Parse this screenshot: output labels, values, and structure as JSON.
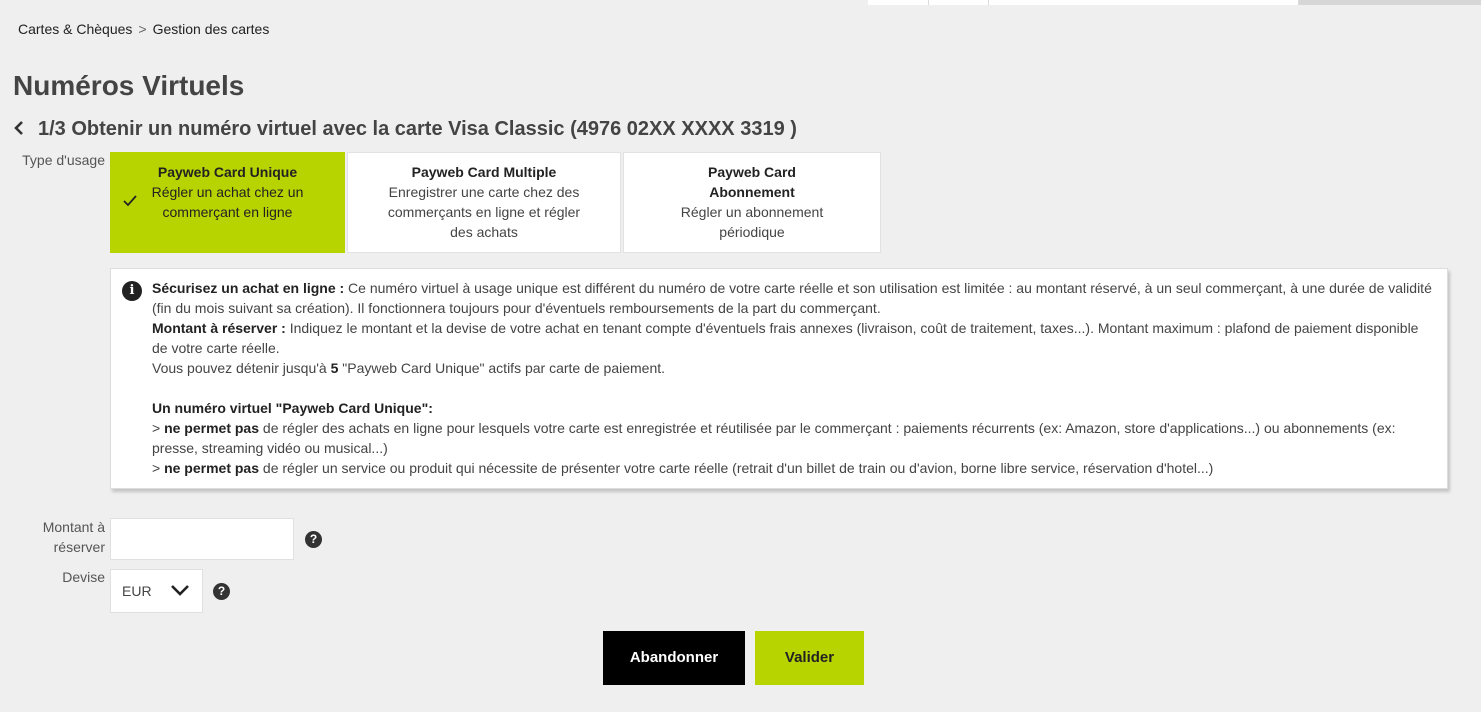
{
  "breadcrumb": {
    "item1": "Cartes & Chèques",
    "separator": ">",
    "item2": "Gestion des cartes"
  },
  "page_title": "Numéros Virtuels",
  "step_title": "1/3 Obtenir un numéro virtuel avec la carte Visa Classic (4976 02XX XXXX 3319 )",
  "usage": {
    "label": "Type d'usage",
    "options": [
      {
        "title": "Payweb Card Unique",
        "description": "Régler un achat chez un commerçant en ligne",
        "selected": true
      },
      {
        "title": "Payweb Card Multiple",
        "description": "Enregistrer une carte chez des commerçants en ligne et régler des achats",
        "selected": false
      },
      {
        "title": "Payweb Card Abonnement",
        "description": "Régler un abonnement périodique",
        "selected": false
      }
    ]
  },
  "info": {
    "p1_bold": "Sécurisez un achat en ligne :",
    "p1_text": " Ce numéro virtuel à usage unique est différent du numéro de votre carte réelle et son utilisation est limitée : au montant réservé, à un seul commerçant, à une durée de validité (fin du mois suivant sa création). Il fonctionnera toujours pour d'éventuels remboursements de la part du commerçant.",
    "p2_bold": "Montant à réserver :",
    "p2_text": " Indiquez le montant et la devise de votre achat en tenant compte d'éventuels frais annexes (livraison, coût de traitement, taxes...). Montant maximum : plafond de paiement disponible de votre carte réelle.",
    "p3_before": "Vous pouvez détenir jusqu'à ",
    "p3_bold": "5",
    "p3_after": " \"Payweb Card Unique\" actifs par carte de paiement.",
    "p4_bold": "Un numéro virtuel \"Payweb Card Unique\":",
    "p5_prefix": "> ",
    "p5_bold": "ne permet pas",
    "p5_text": " de régler des achats en ligne pour lesquels votre carte est enregistrée et réutilisée par le commerçant : paiements récurrents (ex: Amazon, store d'applications...) ou abonnements (ex: presse, streaming vidéo ou musical...)",
    "p6_prefix": "> ",
    "p6_bold": "ne permet pas",
    "p6_text": " de régler un service ou produit qui nécessite de présenter votre carte réelle (retrait d'un billet de train ou d'avion, borne libre service, réservation d'hotel...)"
  },
  "form": {
    "amount_label": "Montant à réserver",
    "amount_value": "",
    "currency_label": "Devise",
    "currency_value": "EUR",
    "help_symbol": "?"
  },
  "buttons": {
    "cancel": "Abandonner",
    "submit": "Valider"
  },
  "icons": {
    "check": "checkmark-icon",
    "back": "chevron-left-icon",
    "info": "info-icon",
    "help": "help-icon",
    "dropdown": "chevron-down-icon"
  },
  "colors": {
    "accent": "#b8d400",
    "cancel_bg": "#000000"
  }
}
